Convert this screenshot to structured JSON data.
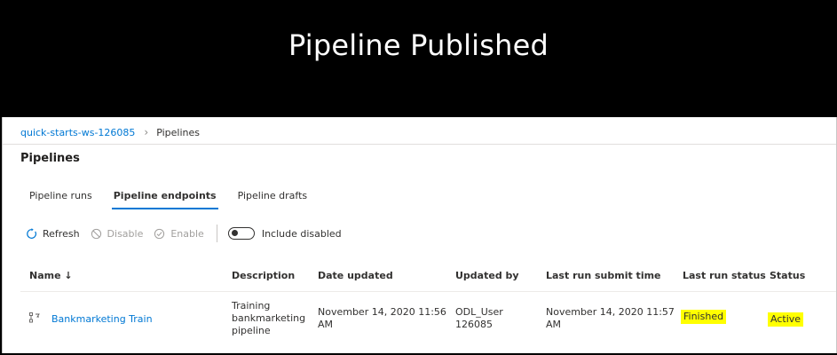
{
  "banner": {
    "title": "Pipeline Published"
  },
  "breadcrumb": {
    "workspace": "quick-starts-ws-126085",
    "separator": "›",
    "current": "Pipelines"
  },
  "page_title": "Pipelines",
  "tabs": [
    {
      "label": "Pipeline runs"
    },
    {
      "label": "Pipeline endpoints"
    },
    {
      "label": "Pipeline drafts"
    }
  ],
  "toolbar": {
    "refresh": "Refresh",
    "disable": "Disable",
    "enable": "Enable",
    "include_disabled": "Include disabled"
  },
  "table": {
    "columns": {
      "name": "Name ↓",
      "description": "Description",
      "date_updated": "Date updated",
      "updated_by": "Updated by",
      "last_run_submit_time": "Last run submit time",
      "last_run_status": "Last run status",
      "status": "Status"
    },
    "rows": [
      {
        "icon": "pipeline-icon",
        "name": "Bankmarketing Train",
        "description_1": "Training",
        "description_2": "bankmarketing",
        "description_3": "pipeline",
        "date_updated_1": "November 14, 2020 11:56",
        "date_updated_2": "AM",
        "updated_by_1": "ODL_User",
        "updated_by_2": "126085",
        "last_run_1": "November 14, 2020 11:57",
        "last_run_2": "AM",
        "last_run_status": "Finished",
        "status": "Active"
      }
    ]
  },
  "colors": {
    "accent": "#0078d4",
    "highlight": "#ffff00",
    "banner": "#000000"
  }
}
